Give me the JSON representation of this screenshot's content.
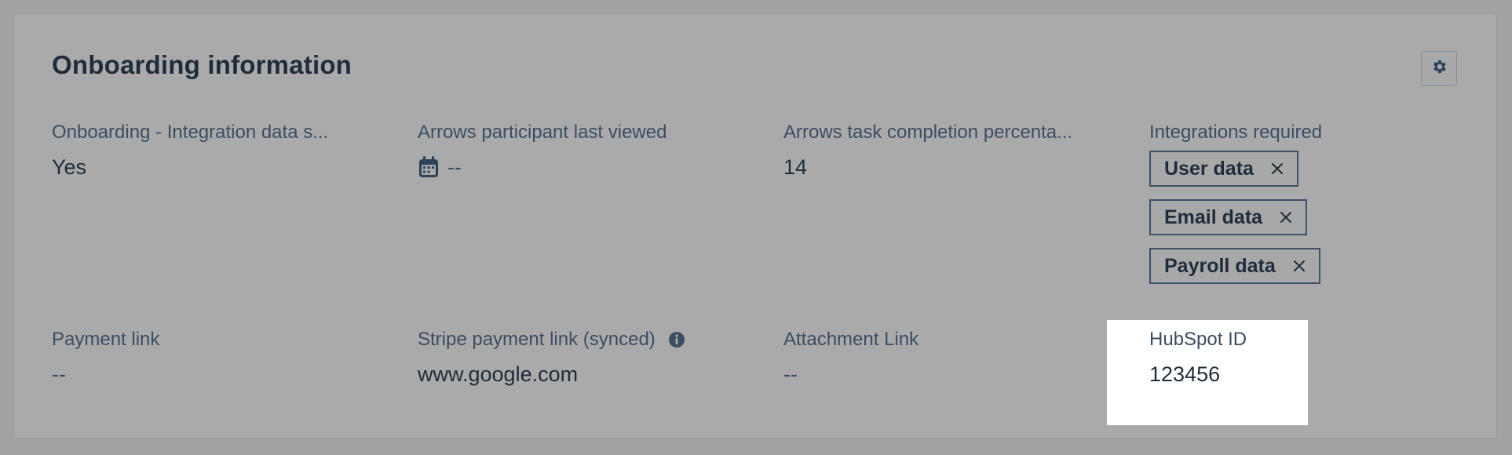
{
  "card": {
    "title": "Onboarding information",
    "settings_icon": "gear-icon"
  },
  "fields": {
    "integration_data": {
      "label": "Onboarding - Integration data s...",
      "value": "Yes"
    },
    "participant_last_viewed": {
      "label": "Arrows participant last viewed",
      "value": "--",
      "icon": "calendar-icon"
    },
    "task_completion": {
      "label": "Arrows task completion percenta...",
      "value": "14"
    },
    "integrations_required": {
      "label": "Integrations required",
      "tags": [
        "User data",
        "Email data",
        "Payroll data"
      ]
    },
    "payment_link": {
      "label": "Payment link",
      "value": "--"
    },
    "stripe_payment_link": {
      "label": "Stripe payment link (synced)",
      "value": "www.google.com",
      "icon": "info-icon"
    },
    "attachment_link": {
      "label": "Attachment Link",
      "value": "--"
    },
    "hubspot_id": {
      "label": "HubSpot ID",
      "value": "123456"
    }
  },
  "colors": {
    "overlay": "#aaaaaa",
    "text_dark": "#1f2c3a",
    "label": "#3b4d62",
    "highlight": "#ffffff"
  }
}
